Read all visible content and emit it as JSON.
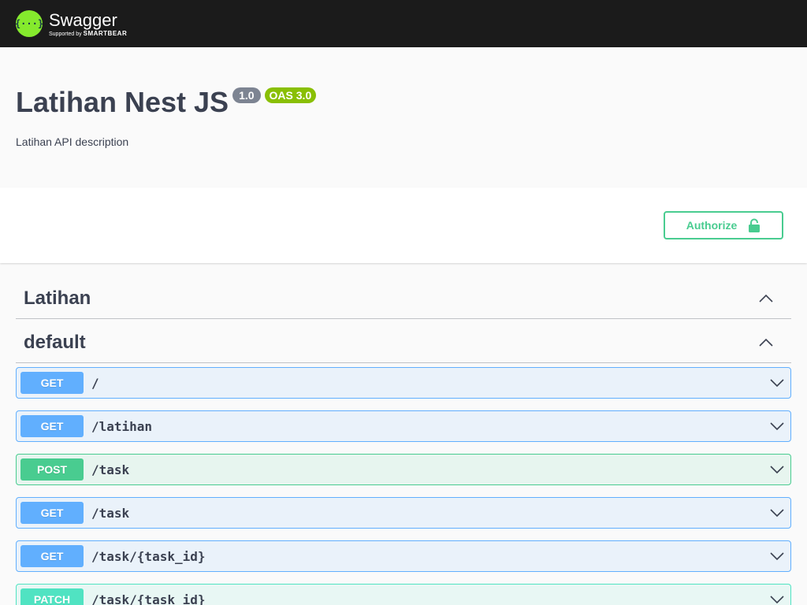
{
  "topbar": {
    "logo_name": "Swagger",
    "logo_sub_prefix": "Supported by",
    "logo_sub_brand": "SMARTBEAR"
  },
  "info": {
    "title": "Latihan Nest JS",
    "version": "1.0",
    "oas": "OAS 3.0",
    "description": "Latihan API description"
  },
  "scheme": {
    "authorize_label": "Authorize"
  },
  "tags": [
    {
      "name": "Latihan"
    },
    {
      "name": "default"
    }
  ],
  "operations": [
    {
      "method": "GET",
      "path": "/"
    },
    {
      "method": "GET",
      "path": "/latihan"
    },
    {
      "method": "POST",
      "path": "/task"
    },
    {
      "method": "GET",
      "path": "/task"
    },
    {
      "method": "GET",
      "path": "/task/{task_id}"
    },
    {
      "method": "PATCH",
      "path": "/task/{task_id}"
    }
  ],
  "colors": {
    "get": "#61affe",
    "post": "#49cc90",
    "patch": "#50e3c2",
    "topbar": "#1b1b1b",
    "swagger_green": "#85ea2d"
  },
  "icons": {
    "logo": "swagger-logo-icon",
    "authorize": "lock-icon",
    "tag_toggle": "chevron-up-icon",
    "op_toggle": "chevron-down-icon"
  }
}
